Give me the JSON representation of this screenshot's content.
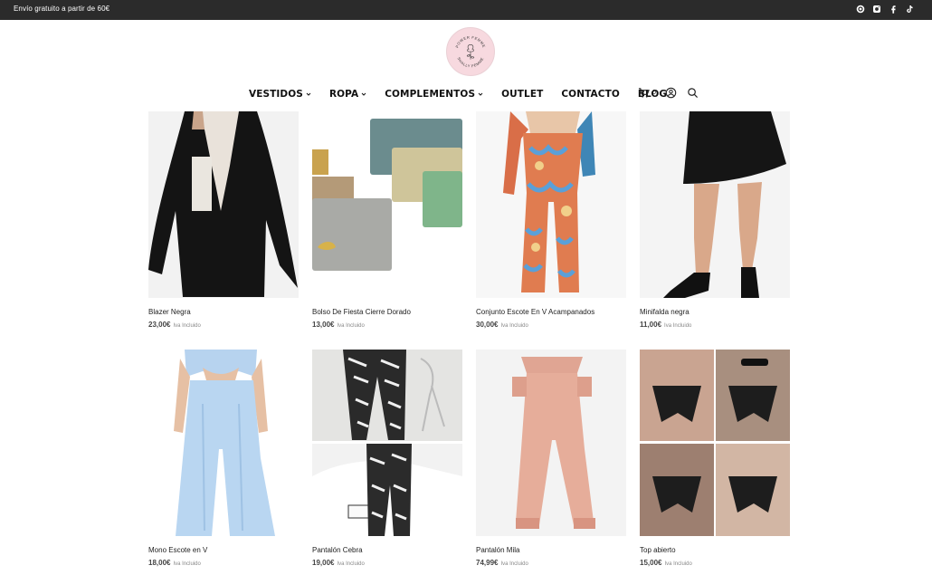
{
  "topbar": {
    "promo_text": "Envío gratuito a partir de 60€",
    "social_icons": [
      "whatsapp-icon",
      "instagram-icon",
      "facebook-icon",
      "tiktok-icon"
    ]
  },
  "logo": {
    "top_text": "POWER FEMME",
    "bottom_text": "SHALLY FEMME"
  },
  "nav": {
    "items": [
      {
        "label": "VESTIDOS",
        "dropdown": true
      },
      {
        "label": "ROPA",
        "dropdown": true
      },
      {
        "label": "COMPLEMENTOS",
        "dropdown": true
      },
      {
        "label": "OUTLET",
        "dropdown": false
      },
      {
        "label": "CONTACTO",
        "dropdown": false
      },
      {
        "label": "BLOG",
        "dropdown": false
      }
    ],
    "cart_count": "0"
  },
  "products": [
    {
      "name": "Blazer Negra",
      "price": "23,00€",
      "tax": "Iva Incluido"
    },
    {
      "name": "Bolso De Fiesta Cierre Dorado",
      "price": "13,00€",
      "tax": "Iva Incluido"
    },
    {
      "name": "Conjunto Escote En V Acampanados",
      "price": "30,00€",
      "tax": "Iva Incluido"
    },
    {
      "name": "Minifalda negra",
      "price": "11,00€",
      "tax": "Iva Incluido"
    },
    {
      "name": "Mono Escote en V",
      "price": "18,00€",
      "tax": "Iva Incluido"
    },
    {
      "name": "Pantalón Cebra",
      "price": "19,00€",
      "tax": "Iva Incluido"
    },
    {
      "name": "Pantalón Mila",
      "price": "74,99€",
      "tax": "Iva Incluido"
    },
    {
      "name": "Top abierto",
      "price": "15,00€",
      "tax": "Iva Incluido"
    }
  ],
  "colors": {
    "topbar_bg": "#2b2b2b",
    "logo_bg": "#f7d9df",
    "text": "#222222"
  }
}
